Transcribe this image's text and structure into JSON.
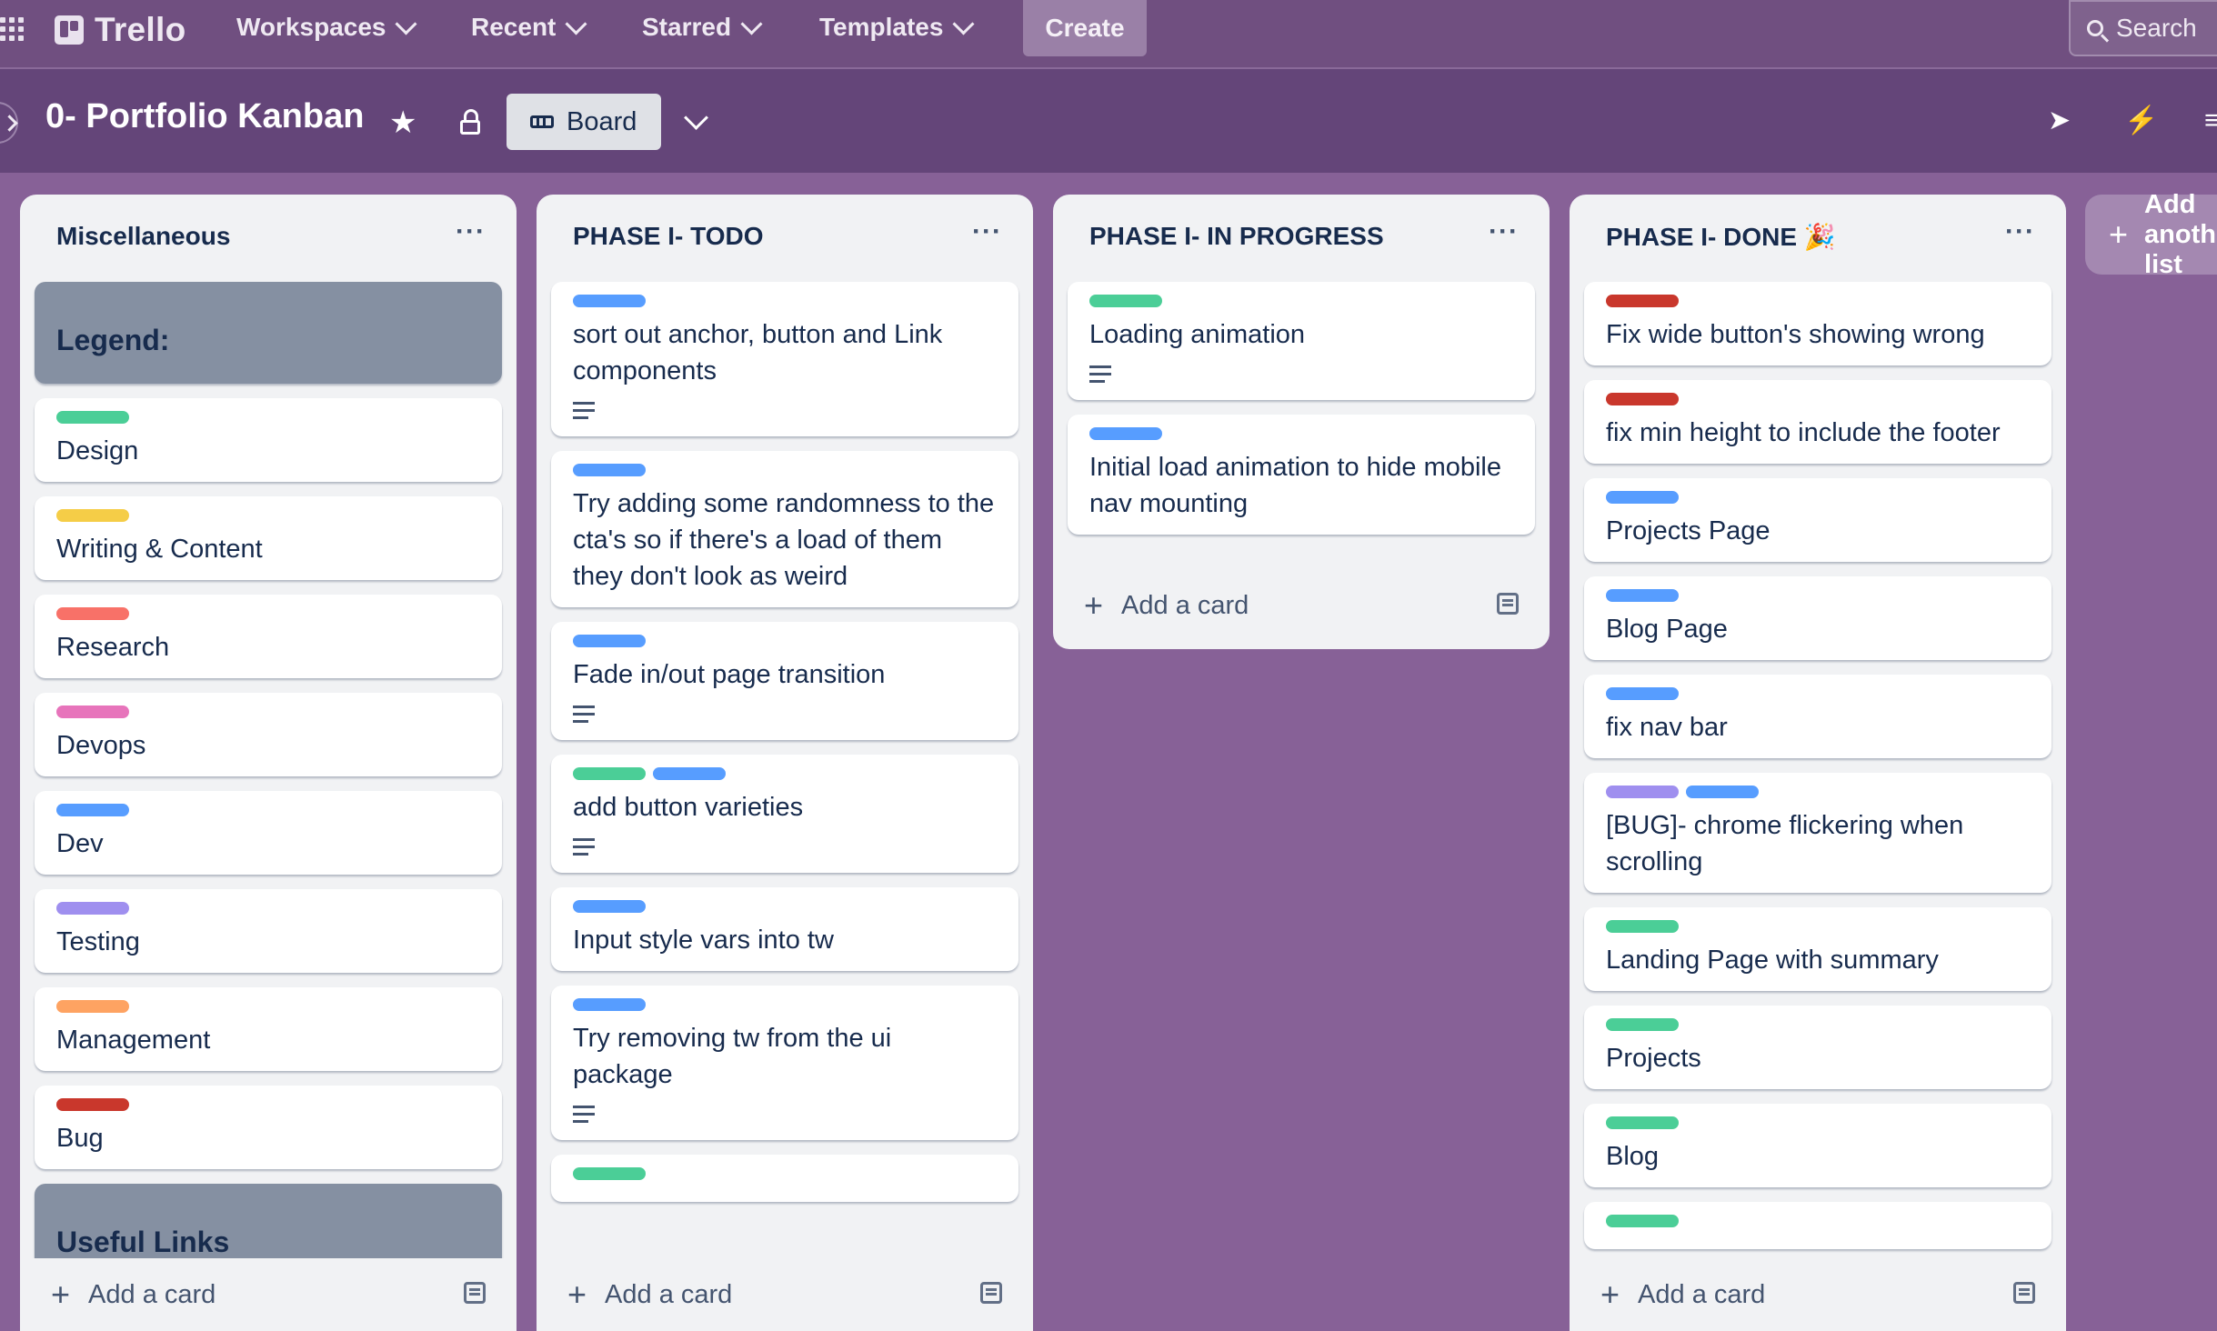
{
  "nav": {
    "brand": "Trello",
    "menus": [
      "Workspaces",
      "Recent",
      "Starred",
      "Templates"
    ],
    "create_label": "Create",
    "search_label": "Search"
  },
  "board": {
    "title": "0- Portfolio Kanban",
    "view_label": "Board"
  },
  "colors": {
    "green": "#4bce97",
    "yellow": "#f5cd47",
    "salmon": "#f87168",
    "pink": "#e774bb",
    "blue": "#579dff",
    "purple": "#9f8fef",
    "orange": "#fea362",
    "red": "#c9372c",
    "board_bg": "#876197"
  },
  "lists": [
    {
      "title": "Miscellaneous",
      "add_label": "Add a card",
      "cards": [
        {
          "title": "Legend:",
          "labels": [],
          "desc": false,
          "cover": true
        },
        {
          "title": "Design",
          "labels": [
            "green"
          ],
          "desc": false
        },
        {
          "title": "Writing & Content",
          "labels": [
            "yellow"
          ],
          "desc": false
        },
        {
          "title": "Research",
          "labels": [
            "salmon"
          ],
          "desc": false
        },
        {
          "title": "Devops",
          "labels": [
            "pink"
          ],
          "desc": false
        },
        {
          "title": "Dev",
          "labels": [
            "blue"
          ],
          "desc": false
        },
        {
          "title": "Testing",
          "labels": [
            "purple"
          ],
          "desc": false
        },
        {
          "title": "Management",
          "labels": [
            "orange"
          ],
          "desc": false
        },
        {
          "title": "Bug",
          "labels": [
            "red"
          ],
          "desc": false
        },
        {
          "title": "Useful Links",
          "labels": [],
          "desc": false,
          "cover": true
        }
      ]
    },
    {
      "title": "PHASE I- TODO",
      "add_label": "Add a card",
      "cards": [
        {
          "title": "sort out anchor, button and Link components",
          "labels": [
            "blue"
          ],
          "desc": true
        },
        {
          "title": "Try adding some randomness to the cta's so if there's a load of them they don't look as weird",
          "labels": [
            "blue"
          ],
          "desc": false
        },
        {
          "title": "Fade in/out page transition",
          "labels": [
            "blue"
          ],
          "desc": true
        },
        {
          "title": "add button varieties",
          "labels": [
            "green",
            "blue"
          ],
          "desc": true
        },
        {
          "title": "Input style vars into tw",
          "labels": [
            "blue"
          ],
          "desc": false
        },
        {
          "title": "Try removing tw from the ui package",
          "labels": [
            "blue"
          ],
          "desc": true
        },
        {
          "title": "",
          "labels": [
            "green"
          ],
          "desc": false
        }
      ]
    },
    {
      "title": "PHASE I- IN PROGRESS",
      "add_label": "Add a card",
      "cards": [
        {
          "title": "Loading animation",
          "labels": [
            "green"
          ],
          "desc": true
        },
        {
          "title": "Initial load animation to hide mobile nav mounting",
          "labels": [
            "blue"
          ],
          "desc": false
        }
      ]
    },
    {
      "title": "PHASE I- DONE 🎉",
      "add_label": "Add a card",
      "cards": [
        {
          "title": "Fix wide button's showing wrong",
          "labels": [
            "red"
          ],
          "desc": false
        },
        {
          "title": "fix min height to include the footer",
          "labels": [
            "red"
          ],
          "desc": false
        },
        {
          "title": "Projects Page",
          "labels": [
            "blue"
          ],
          "desc": false
        },
        {
          "title": "Blog Page",
          "labels": [
            "blue"
          ],
          "desc": false
        },
        {
          "title": "fix nav bar",
          "labels": [
            "blue"
          ],
          "desc": false
        },
        {
          "title": "[BUG]- chrome flickering when scrolling",
          "labels": [
            "purple",
            "blue"
          ],
          "desc": false
        },
        {
          "title": "Landing Page with summary",
          "labels": [
            "green"
          ],
          "desc": false
        },
        {
          "title": "Projects",
          "labels": [
            "green"
          ],
          "desc": false
        },
        {
          "title": "Blog",
          "labels": [
            "green"
          ],
          "desc": false
        },
        {
          "title": "",
          "labels": [
            "green"
          ],
          "desc": false
        }
      ]
    }
  ],
  "add_list_label": "Add another list"
}
